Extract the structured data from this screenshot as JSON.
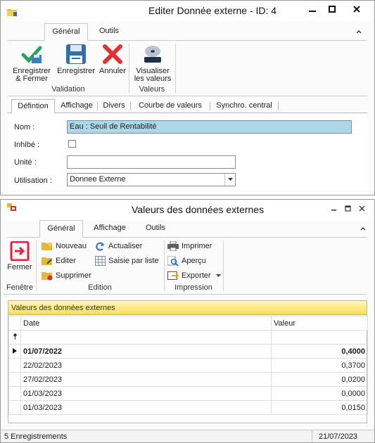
{
  "editor": {
    "title": "Editer Donnée externe - ID: 4",
    "ribbon_tabs": [
      "Général",
      "Outils"
    ],
    "actions": {
      "save_close_line1": "Enregistrer",
      "save_close_line2": "& Fermer",
      "save": "Enregistrer",
      "cancel": "Annuler",
      "view_line1": "Visualiser",
      "view_line2": "les valeurs"
    },
    "groups": {
      "validation": "Validation",
      "values": "Valeurs"
    },
    "form_tabs": [
      "Défintion",
      "Affichage",
      "Divers",
      "Courbe de valeurs",
      "Synchro. central"
    ],
    "fields": {
      "name_label": "Nom :",
      "name_value": "Eau : Seuil de Rentabilité",
      "inhibited_label": "Inhibé :",
      "inhibited_checked": false,
      "unit_label": "Unité :",
      "unit_value": "",
      "usage_label": "Utilisation :",
      "usage_value": "Donnee Externe"
    }
  },
  "values_window": {
    "title": "Valeurs des données externes",
    "ribbon_tabs": [
      "Général",
      "Affichage",
      "Outils"
    ],
    "actions": {
      "close": "Fermer",
      "new": "Nouveau",
      "edit": "Editer",
      "delete": "Supprimer",
      "refresh": "Actualiser",
      "list_entry": "Saisie par liste",
      "print": "Imprimer",
      "preview": "Aperçu",
      "export": "Exporter"
    },
    "groups": {
      "window": "Fenêtre",
      "edition": "Edition",
      "printing": "Impression"
    },
    "grid": {
      "caption": "Valeurs des données externes",
      "columns": [
        "Date",
        "Valeur"
      ],
      "rows": [
        {
          "date": "01/07/2022",
          "value": "0,4000",
          "current": true
        },
        {
          "date": "22/02/2023",
          "value": "0,3700"
        },
        {
          "date": "27/02/2023",
          "value": "0,0200"
        },
        {
          "date": "01/03/2023",
          "value": "0,0000"
        },
        {
          "date": "01/03/2023",
          "value": "0,0150"
        }
      ]
    },
    "status": {
      "records": "5 Enregistrements",
      "date": "21/07/2023"
    }
  },
  "colors": {
    "selection": "#add8e9",
    "grid_header": "#f8df58",
    "accept": "#2aa05a",
    "cancel": "#e03232",
    "close_icon": "#e8203c"
  }
}
